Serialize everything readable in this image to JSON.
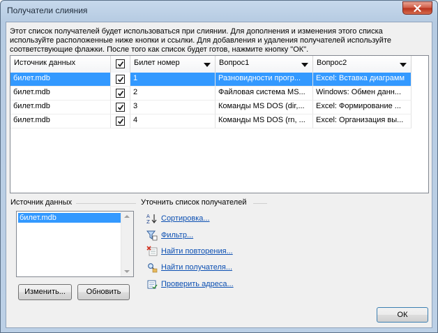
{
  "window": {
    "title": "Получатели слияния"
  },
  "intro_text": "Этот список получателей будет использоваться при слиянии. Для дополнения и изменения этого списка используйте расположенные ниже кнопки и ссылки. Для добавления и удаления получателей используйте соответствующие флажки. После того как список будет готов, нажмите кнопку \"ОК\".",
  "grid": {
    "columns": [
      {
        "label": "Источник данных"
      },
      {
        "label": ""
      },
      {
        "label": "Билет номер"
      },
      {
        "label": "Вопрос1"
      },
      {
        "label": "Вопрос2"
      }
    ],
    "rows": [
      {
        "source": "билет.mdb",
        "checked": true,
        "num": "1",
        "q1": "Разновидности прогр...",
        "q2": "Excel: Вставка диаграмм",
        "selected": true
      },
      {
        "source": "билет.mdb",
        "checked": true,
        "num": "2",
        "q1": "Файловая система MS...",
        "q2": "Windows: Обмен данн...",
        "selected": false
      },
      {
        "source": "билет.mdb",
        "checked": true,
        "num": "3",
        "q1": "Команды MS DOS (dir,...",
        "q2": "Excel: Формирование ...",
        "selected": false
      },
      {
        "source": "билет.mdb",
        "checked": true,
        "num": "4",
        "q1": "Команды MS DOS (rn, ...",
        "q2": "Excel: Организация вы...",
        "selected": false
      }
    ]
  },
  "data_sources": {
    "label": "Источник данных",
    "items": [
      "билет.mdb"
    ],
    "edit_button": "Изменить...",
    "refresh_button": "Обновить"
  },
  "refine": {
    "label": "Уточнить список получателей",
    "links": [
      {
        "label": "Сортировка...",
        "icon": "sort-az-icon"
      },
      {
        "label": "Фильтр...",
        "icon": "filter-icon"
      },
      {
        "label": "Найти повторения...",
        "icon": "find-duplicates-icon"
      },
      {
        "label": "Найти получателя...",
        "icon": "find-recipient-icon"
      },
      {
        "label": "Проверить адреса...",
        "icon": "validate-addresses-icon"
      }
    ]
  },
  "ok_button": "ОК",
  "colors": {
    "selection": "#3399ff",
    "link": "#0b4fb2"
  }
}
